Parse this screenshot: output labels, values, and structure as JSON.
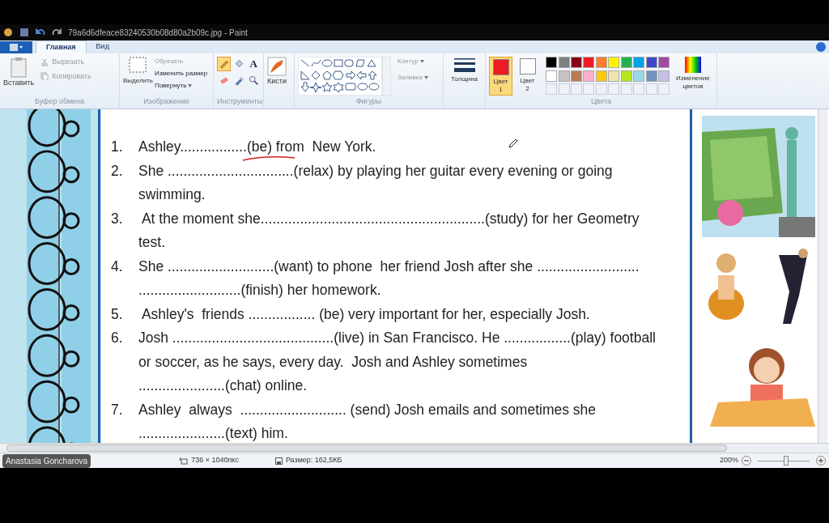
{
  "window": {
    "title": "79a6d6dfeace83240530b08d80a2b09c.jpg - Paint"
  },
  "tabs": [
    {
      "label": "Главная",
      "selected": true
    },
    {
      "label": "Вид",
      "selected": false
    }
  ],
  "ribbon": {
    "clipboard": {
      "paste": "Вставить",
      "cut": "Вырезать",
      "copy": "Копировать",
      "label": "Буфер обмена"
    },
    "image": {
      "select": "Выделить",
      "crop": "Обрезать",
      "resize": "Изменить размер",
      "rotate": "Повернуть",
      "label": "Изображение"
    },
    "tools": {
      "label": "Инструменты",
      "items": [
        {
          "kind": "pencil",
          "selected": true
        },
        {
          "kind": "fill",
          "selected": false
        },
        {
          "kind": "text",
          "glyph": "A",
          "selected": false
        },
        {
          "kind": "eraser",
          "selected": false
        },
        {
          "kind": "picker",
          "selected": false
        },
        {
          "kind": "magnifier",
          "selected": false
        }
      ]
    },
    "brushes": {
      "button": "Кисти"
    },
    "shapes": {
      "label": "Фигуры",
      "outline": "Контур",
      "fill": "Заливка"
    },
    "thickness": {
      "button": "Толщина"
    },
    "colors": {
      "label": "Цвета",
      "color1": {
        "label": "Цвет",
        "index": "1",
        "color": "#ed1c24",
        "selected": true
      },
      "color2": {
        "label": "Цвет",
        "index": "2",
        "color": "#ffffff",
        "selected": false
      },
      "palette": [
        {
          "color": "#000000"
        },
        {
          "color": "#7f7f7f"
        },
        {
          "color": "#880015"
        },
        {
          "color": "#ed1c24"
        },
        {
          "color": "#ff7f27"
        },
        {
          "color": "#fff200"
        },
        {
          "color": "#22b14c"
        },
        {
          "color": "#00a2e8"
        },
        {
          "color": "#3f48cc"
        },
        {
          "color": "#a349a4"
        },
        {
          "color": "#ffffff"
        },
        {
          "color": "#c3c3c3"
        },
        {
          "color": "#b97a57"
        },
        {
          "color": "#ffaec9"
        },
        {
          "color": "#ffc90e"
        },
        {
          "color": "#efe4b0"
        },
        {
          "color": "#b5e61d"
        },
        {
          "color": "#99d9ea"
        },
        {
          "color": "#7092be"
        },
        {
          "color": "#c8bfe7"
        }
      ],
      "edit": "Изменение цветов"
    }
  },
  "worksheet": {
    "items": [
      {
        "number": "1.",
        "lines": [
          "Ashley.................(be) from  New York."
        ]
      },
      {
        "number": "2.",
        "lines": [
          "She ................................(relax) by playing her guitar every evening or going",
          "swimming."
        ]
      },
      {
        "number": "3.",
        "lines": [
          " At the moment she.........................................................(study) for her Geometry",
          "test."
        ]
      },
      {
        "number": "4.",
        "lines": [
          "She ...........................(want) to phone  her friend Josh after she ..........................",
          "..........................(finish) her homework."
        ]
      },
      {
        "number": "5.",
        "lines": [
          " Ashley's  friends ................. (be) very important for her, especially Josh."
        ]
      },
      {
        "number": "6.",
        "lines": [
          "Josh .........................................(live) in San Francisco. He .................(play) football",
          "or soccer, as he says, every day.  Josh and Ashley sometimes",
          "......................(chat) online."
        ]
      },
      {
        "number": "7.",
        "lines": [
          "Ashley  always  ........................... (send) Josh emails and sometimes she",
          "......................(text) him."
        ]
      }
    ]
  },
  "status_bar": {
    "overlay_name": "Anastasia Goncharova",
    "dimensions": "736 × 1040пкс",
    "size": "Размер: 162,5КБ",
    "zoom": "200%",
    "zoom_slider": {
      "level": 0.55
    }
  }
}
